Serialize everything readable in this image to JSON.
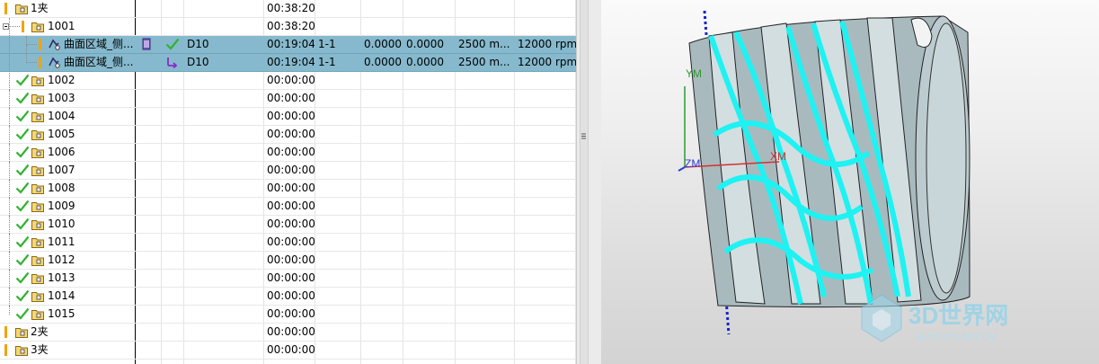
{
  "navigator": {
    "rows": [
      {
        "name": "1夹",
        "time": "00:38:20"
      },
      {
        "name": "1001",
        "time": "00:38:20"
      },
      {
        "name": "曲面区域_侧...",
        "tool": "D10",
        "time": "00:19:04",
        "geometry": "1-1",
        "stock_side": "0.0000",
        "stock_floor": "0.0000",
        "feed": "2500 m...",
        "speed": "12000 rpm"
      },
      {
        "name": "曲面区域_侧...",
        "tool": "D10",
        "time": "00:19:04",
        "geometry": "1-1",
        "stock_side": "0.0000",
        "stock_floor": "0.0000",
        "feed": "2500 m...",
        "speed": "12000 rpm"
      },
      {
        "name": "1002",
        "time": "00:00:00"
      },
      {
        "name": "1003",
        "time": "00:00:00"
      },
      {
        "name": "1004",
        "time": "00:00:00"
      },
      {
        "name": "1005",
        "time": "00:00:00"
      },
      {
        "name": "1006",
        "time": "00:00:00"
      },
      {
        "name": "1007",
        "time": "00:00:00"
      },
      {
        "name": "1008",
        "time": "00:00:00"
      },
      {
        "name": "1009",
        "time": "00:00:00"
      },
      {
        "name": "1010",
        "time": "00:00:00"
      },
      {
        "name": "1011",
        "time": "00:00:00"
      },
      {
        "name": "1012",
        "time": "00:00:00"
      },
      {
        "name": "1013",
        "time": "00:00:00"
      },
      {
        "name": "1014",
        "time": "00:00:00"
      },
      {
        "name": "1015",
        "time": "00:00:00"
      },
      {
        "name": "2夹",
        "time": "00:00:00"
      },
      {
        "name": "3夹",
        "time": "00:00:00"
      }
    ]
  },
  "viewport": {
    "axis_y": "YM",
    "axis_x": "XM",
    "axis_z": "ZM",
    "watermark_title": "3D世界网",
    "watermark_url": "WWW.3DSJW.COM",
    "colors": {
      "toolpath": "#1ef2f2",
      "part": "#b8c8cc",
      "axis_x": "#d43030",
      "axis_y": "#2e9a2e",
      "axis_z": "#2d3dd6"
    }
  },
  "icons": {
    "expand": "minus-box-icon",
    "folder": "program-folder-icon",
    "done": "check-icon",
    "operation": "operation-icon",
    "splitter": "splitter-grip-icon"
  }
}
